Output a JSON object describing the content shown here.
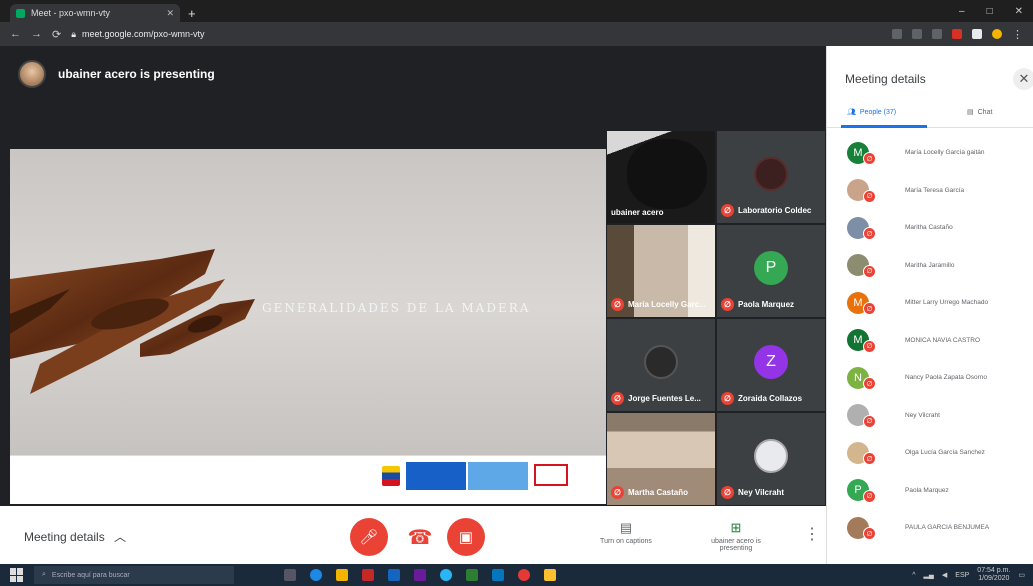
{
  "browser": {
    "tab_title": "Meet - pxo-wmn-vty",
    "url": "meet.google.com/pxo-wmn-vty",
    "new_tab": "+",
    "window_controls": [
      "–",
      "□",
      "✕"
    ],
    "tab_close": "✕"
  },
  "stage": {
    "presenter_text": "ubainer acero is presenting",
    "slide_title": "GENERALIDADES DE LA MADERA"
  },
  "tiles": [
    {
      "name": "ubainer acero",
      "muted": false
    },
    {
      "name": "Laboratorio Coldec",
      "muted": true
    },
    {
      "name": "María Locelly Garc...",
      "muted": true
    },
    {
      "name": "Paola Marquez",
      "muted": true,
      "initial": "P",
      "color": "#34a853"
    },
    {
      "name": "Jorge Fuentes Le...",
      "muted": true
    },
    {
      "name": "Zoraida Collazos",
      "muted": true,
      "initial": "Z",
      "color": "#9334e6"
    },
    {
      "name": "Martha Castaño",
      "muted": true
    },
    {
      "name": "Ney Vilcraht",
      "muted": true
    }
  ],
  "bottom": {
    "meeting_details": "Meeting details",
    "captions_label": "Turn on captions",
    "presenting_label": "ubainer acero is presenting",
    "more": "⋮"
  },
  "panel": {
    "title": "Meeting details",
    "close": "✕",
    "tab_people": "People (37)",
    "tab_chat": "Chat",
    "people": [
      {
        "name": "María Locelly García gaitán",
        "initial": "M",
        "color": "#188038"
      },
      {
        "name": "María Teresa García",
        "initial": "",
        "color": "#c9a48a"
      },
      {
        "name": "Maritha Castaño",
        "initial": "",
        "color": "#7d8fa6"
      },
      {
        "name": "Maritha Jaramillo",
        "initial": "",
        "color": "#8c8c70"
      },
      {
        "name": "Mitter Larry Urrego Machado",
        "initial": "M",
        "color": "#e8710a"
      },
      {
        "name": "MONICA NAVIA CASTRO",
        "initial": "M",
        "color": "#137333"
      },
      {
        "name": "Nancy Paola Zapata Osorno",
        "initial": "N",
        "color": "#7cb342"
      },
      {
        "name": "Ney Vilcraht",
        "initial": "",
        "color": "#b0b0b0"
      },
      {
        "name": "Olga Lucía García Sanchez",
        "initial": "",
        "color": "#d3b58e"
      },
      {
        "name": "Paola Marquez",
        "initial": "P",
        "color": "#34a853"
      },
      {
        "name": "PAULA GARCIA BENJUMEA",
        "initial": "",
        "color": "#a37b5b"
      }
    ]
  },
  "taskbar": {
    "search_placeholder": "Escribe aquí para buscar",
    "tray_lang": "ESP",
    "time": "07:54 p.m.",
    "date": "1/09/2020"
  },
  "colors": {
    "mute_red": "#ea4335",
    "accent_blue": "#1a73e8",
    "end_call_red": "#ea4335"
  }
}
